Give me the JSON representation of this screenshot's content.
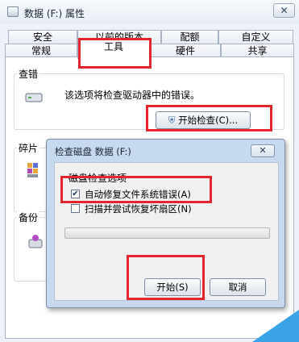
{
  "window": {
    "title": "数据 (F:) 属性",
    "close_glyph": "✕"
  },
  "tabs_row1": [
    "安全",
    "以前的版本",
    "配额",
    "自定义"
  ],
  "tabs_row2": [
    "常规",
    "工具",
    "硬件",
    "共享"
  ],
  "selected_tab": "工具",
  "error_check": {
    "group_title": "查错",
    "description": "该选项将检查驱动器中的错误。",
    "button_label": "开始检查(C)..."
  },
  "defrag": {
    "group_title": "碎片"
  },
  "backup": {
    "group_title": "备份"
  },
  "dialog": {
    "title": "检查磁盘 数据 (F:)",
    "close_glyph": "✕",
    "options_title": "磁盘检查选项",
    "option_fix": {
      "label": "自动修复文件系统错误(A)",
      "checked": true
    },
    "option_scan": {
      "label": "扫描并尝试恢复坏扇区(N)",
      "checked": false
    },
    "progress": 0,
    "start_label": "开始(S)",
    "cancel_label": "取消"
  },
  "colors": {
    "highlight": "#e3252d",
    "accent": "#3aa3e6"
  }
}
